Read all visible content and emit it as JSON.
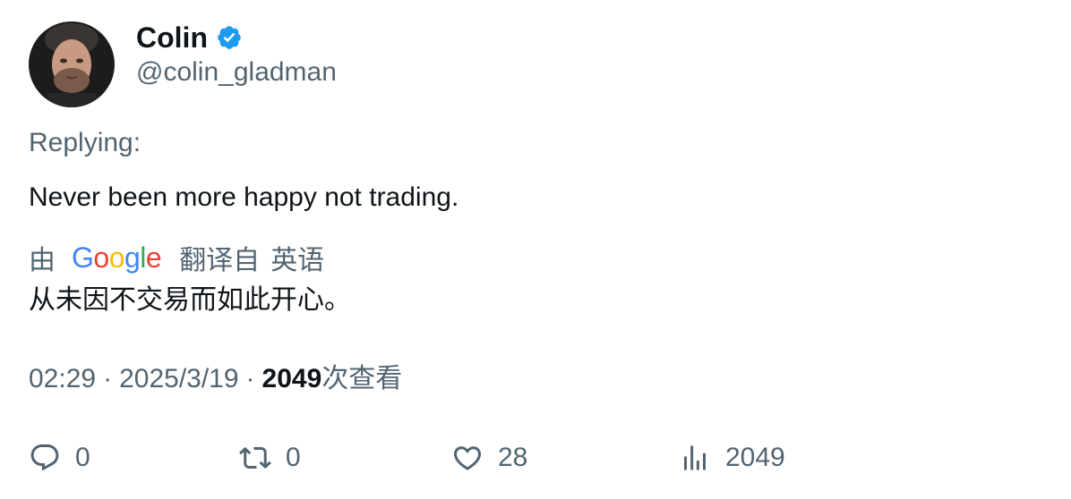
{
  "author": {
    "display_name": "Colin",
    "handle": "@colin_gladman",
    "verified": true
  },
  "replying_label": "Replying:",
  "tweet_text": "Never been more happy not trading.",
  "translation": {
    "by_label": "由",
    "provider": "Google",
    "from_label": "翻译自",
    "language": "英语",
    "text": "从未因不交易而如此开心。"
  },
  "meta": {
    "time": "02:29",
    "separator": "·",
    "date": "2025/3/19",
    "views_count": "2049",
    "views_label": "次查看"
  },
  "actions": {
    "replies": "0",
    "retweets": "0",
    "likes": "28",
    "views": "2049"
  },
  "colors": {
    "primary_text": "#0f1419",
    "secondary_text": "#536471",
    "verified_blue": "#1d9bf0"
  }
}
